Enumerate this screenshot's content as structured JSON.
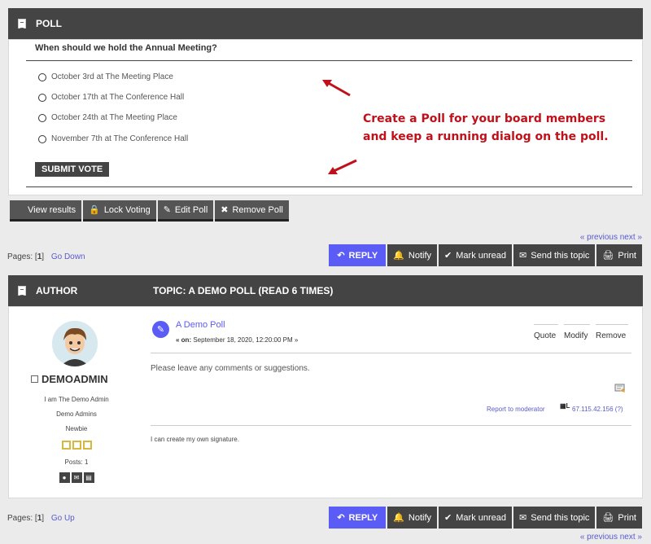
{
  "poll": {
    "header": "POLL",
    "question": "When should we hold the Annual Meeting?",
    "options": [
      "October 3rd  at  The Meeting Place",
      "October 17th at  The Conference Hall",
      "October 24th at  The Meeting Place",
      "November 7th at  The Conference Hall"
    ],
    "submit_label": "SUBMIT VOTE",
    "callout_line1": "Create a Poll for your board members",
    "callout_line2": "and keep a running dialog on the poll.",
    "buttons": {
      "view_results": "View results",
      "lock_voting": "Lock Voting",
      "edit_poll": "Edit Poll",
      "remove_poll": "Remove Poll"
    }
  },
  "nav": {
    "prev_next": "« previous next »",
    "pages_label": "Pages: [",
    "current_page": "1",
    "pages_close": "]",
    "go_down": "Go Down",
    "go_up": "Go Up"
  },
  "actions": {
    "reply": "REPLY",
    "notify": "Notify",
    "mark_unread": "Mark unread",
    "send_topic": "Send this topic",
    "print": "Print"
  },
  "topic": {
    "author_header": "AUTHOR",
    "topic_header": "TOPIC: A DEMO POLL  (READ 6 TIMES)"
  },
  "post": {
    "author_name": "DEMOADMIN",
    "author_title": "I am The Demo Admin",
    "group": "Demo Admins",
    "rank": "Newbie",
    "posts": "Posts: 1",
    "stars": 3,
    "title": "A Demo Poll",
    "on_label": "« on:",
    "date": "September 18, 2020, 12:20:00 PM »",
    "quote": "Quote",
    "modify": "Modify",
    "remove": "Remove",
    "body": "Please leave any comments or suggestions.",
    "report": "Report to moderator",
    "ip": "67.115.42.156 (?)",
    "signature": "I can create my own signature."
  },
  "colors": {
    "header_bg": "#444444",
    "accent": "#5b5bf5",
    "callout": "#c0111b",
    "star": "#d6b83c"
  }
}
